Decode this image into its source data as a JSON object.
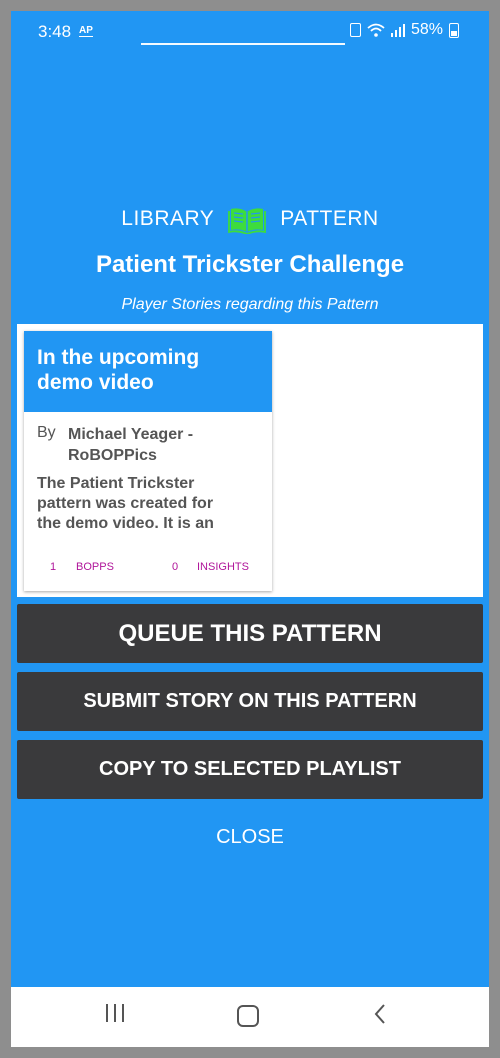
{
  "status_bar": {
    "time": "3:48",
    "ap_badge": "AP",
    "battery_percent": "58%"
  },
  "header": {
    "library_label": "LIBRARY",
    "pattern_label": "PATTERN",
    "title": "Patient Trickster Challenge",
    "subtitle": "Player Stories regarding this Pattern"
  },
  "story_card": {
    "title": "In the upcoming demo video",
    "by_label": "By",
    "author": "Michael Yeager - RoBOPPics",
    "excerpt": "The Patient Trickster pattern was created for the demo video. It is an",
    "bopps_count": "1",
    "bopps_label": "BOPPS",
    "insights_count": "0",
    "insights_label": "INSIGHTS"
  },
  "actions": {
    "queue": "QUEUE THIS PATTERN",
    "submit_story": "SUBMIT STORY ON THIS PATTERN",
    "copy_playlist": "COPY TO SELECTED PLAYLIST",
    "close": "CLOSE"
  },
  "colors": {
    "background": "#2196f3",
    "button": "#3a3a3c",
    "accent_green": "#3ddc3d",
    "count_magenta": "#b0159a"
  },
  "nav_bar": {
    "recents_icon": "recents-icon",
    "home_icon": "home-icon",
    "back_icon": "back-icon"
  }
}
